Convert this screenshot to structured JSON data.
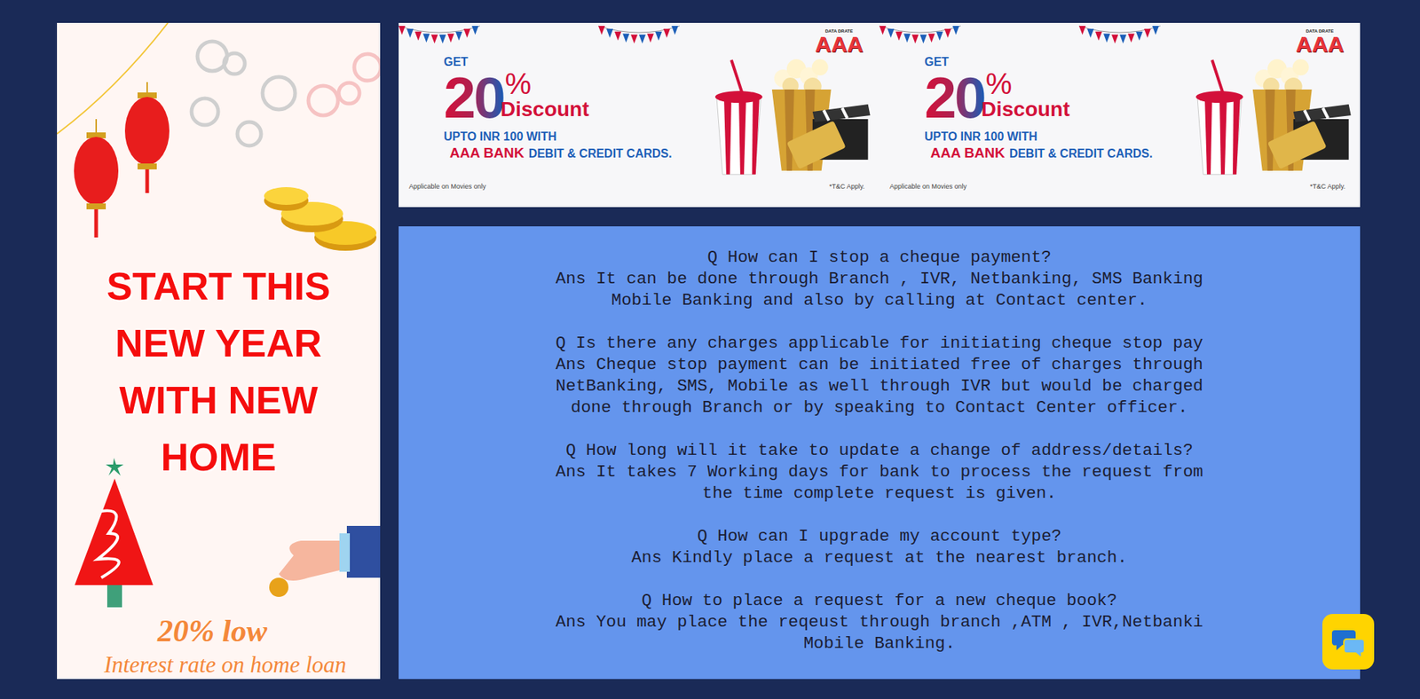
{
  "home_loan_banner": {
    "title_lines": [
      "START THIS",
      "NEW YEAR",
      "WITH NEW",
      "HOME"
    ],
    "rate": "20% low",
    "caption": "Interest rate on home loan"
  },
  "offer_banners": [
    {
      "logo_caption": "DATA DRATE",
      "logo": "AAA",
      "get": "GET",
      "percent": "20",
      "percent_sign": "%",
      "discount": "Discount",
      "upto": "UPTO INR 100 WITH",
      "bank": "AAA BANK",
      "cards": "DEBIT & CREDIT CARDS.",
      "note": "Applicable on Movies only",
      "terms": "*T&C Apply."
    },
    {
      "logo_caption": "DATA DRATE",
      "logo": "AAA",
      "get": "GET",
      "percent": "20",
      "percent_sign": "%",
      "discount": "Discount",
      "upto": "UPTO INR 100 WITH",
      "bank": "AAA BANK",
      "cards": "DEBIT & CREDIT CARDS.",
      "note": "Applicable on Movies only",
      "terms": "*T&C Apply."
    }
  ],
  "faq": [
    {
      "question": "Q How can I stop a cheque payment?",
      "answer_lines": [
        "Ans It can be done through Branch , IVR, Netbanking, SMS Banking",
        "Mobile Banking and also by calling at Contact center."
      ]
    },
    {
      "question": "Q Is there any charges applicable for initiating cheque stop pay",
      "answer_lines": [
        "Ans Cheque stop payment can be initiated free of charges through",
        "NetBanking, SMS, Mobile as well through IVR but would be charged",
        "done through Branch or by speaking to Contact Center officer."
      ]
    },
    {
      "question": "Q How long will it take to update a change of address/details?",
      "answer_lines": [
        "Ans It takes 7 Working days for bank to process the request from",
        "the time complete request is given."
      ]
    },
    {
      "question": "Q How can I upgrade my account type?",
      "answer_lines": [
        "Ans Kindly place a request at the nearest branch."
      ]
    },
    {
      "question": "Q How to place a request for a new cheque book?",
      "answer_lines": [
        "Ans You may place the reqeust through branch ,ATM , IVR,Netbanki",
        "Mobile Banking."
      ]
    }
  ]
}
